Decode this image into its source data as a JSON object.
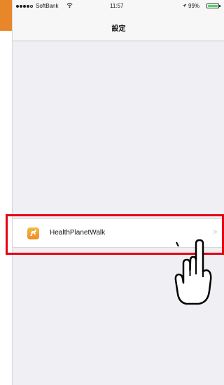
{
  "status_bar": {
    "carrier": "SoftBank",
    "time": "11:57",
    "battery": "99%",
    "icons": [
      "signal-dots-icon",
      "wifi-icon",
      "location-arrow-icon",
      "battery-icon"
    ],
    "battery_level": 0.99
  },
  "nav": {
    "title": "設定"
  },
  "settings": {
    "items": [
      {
        "label": "HealthPlanetWalk",
        "icon": "healthplanetwalk-app-icon"
      }
    ]
  },
  "annotations": {
    "highlight_color": "#e60012",
    "pointer": "pointing-hand-icon"
  },
  "colors": {
    "accent_tab": "#e8872a",
    "app_icon": "#f0a030",
    "battery_green": "#4cd964"
  }
}
